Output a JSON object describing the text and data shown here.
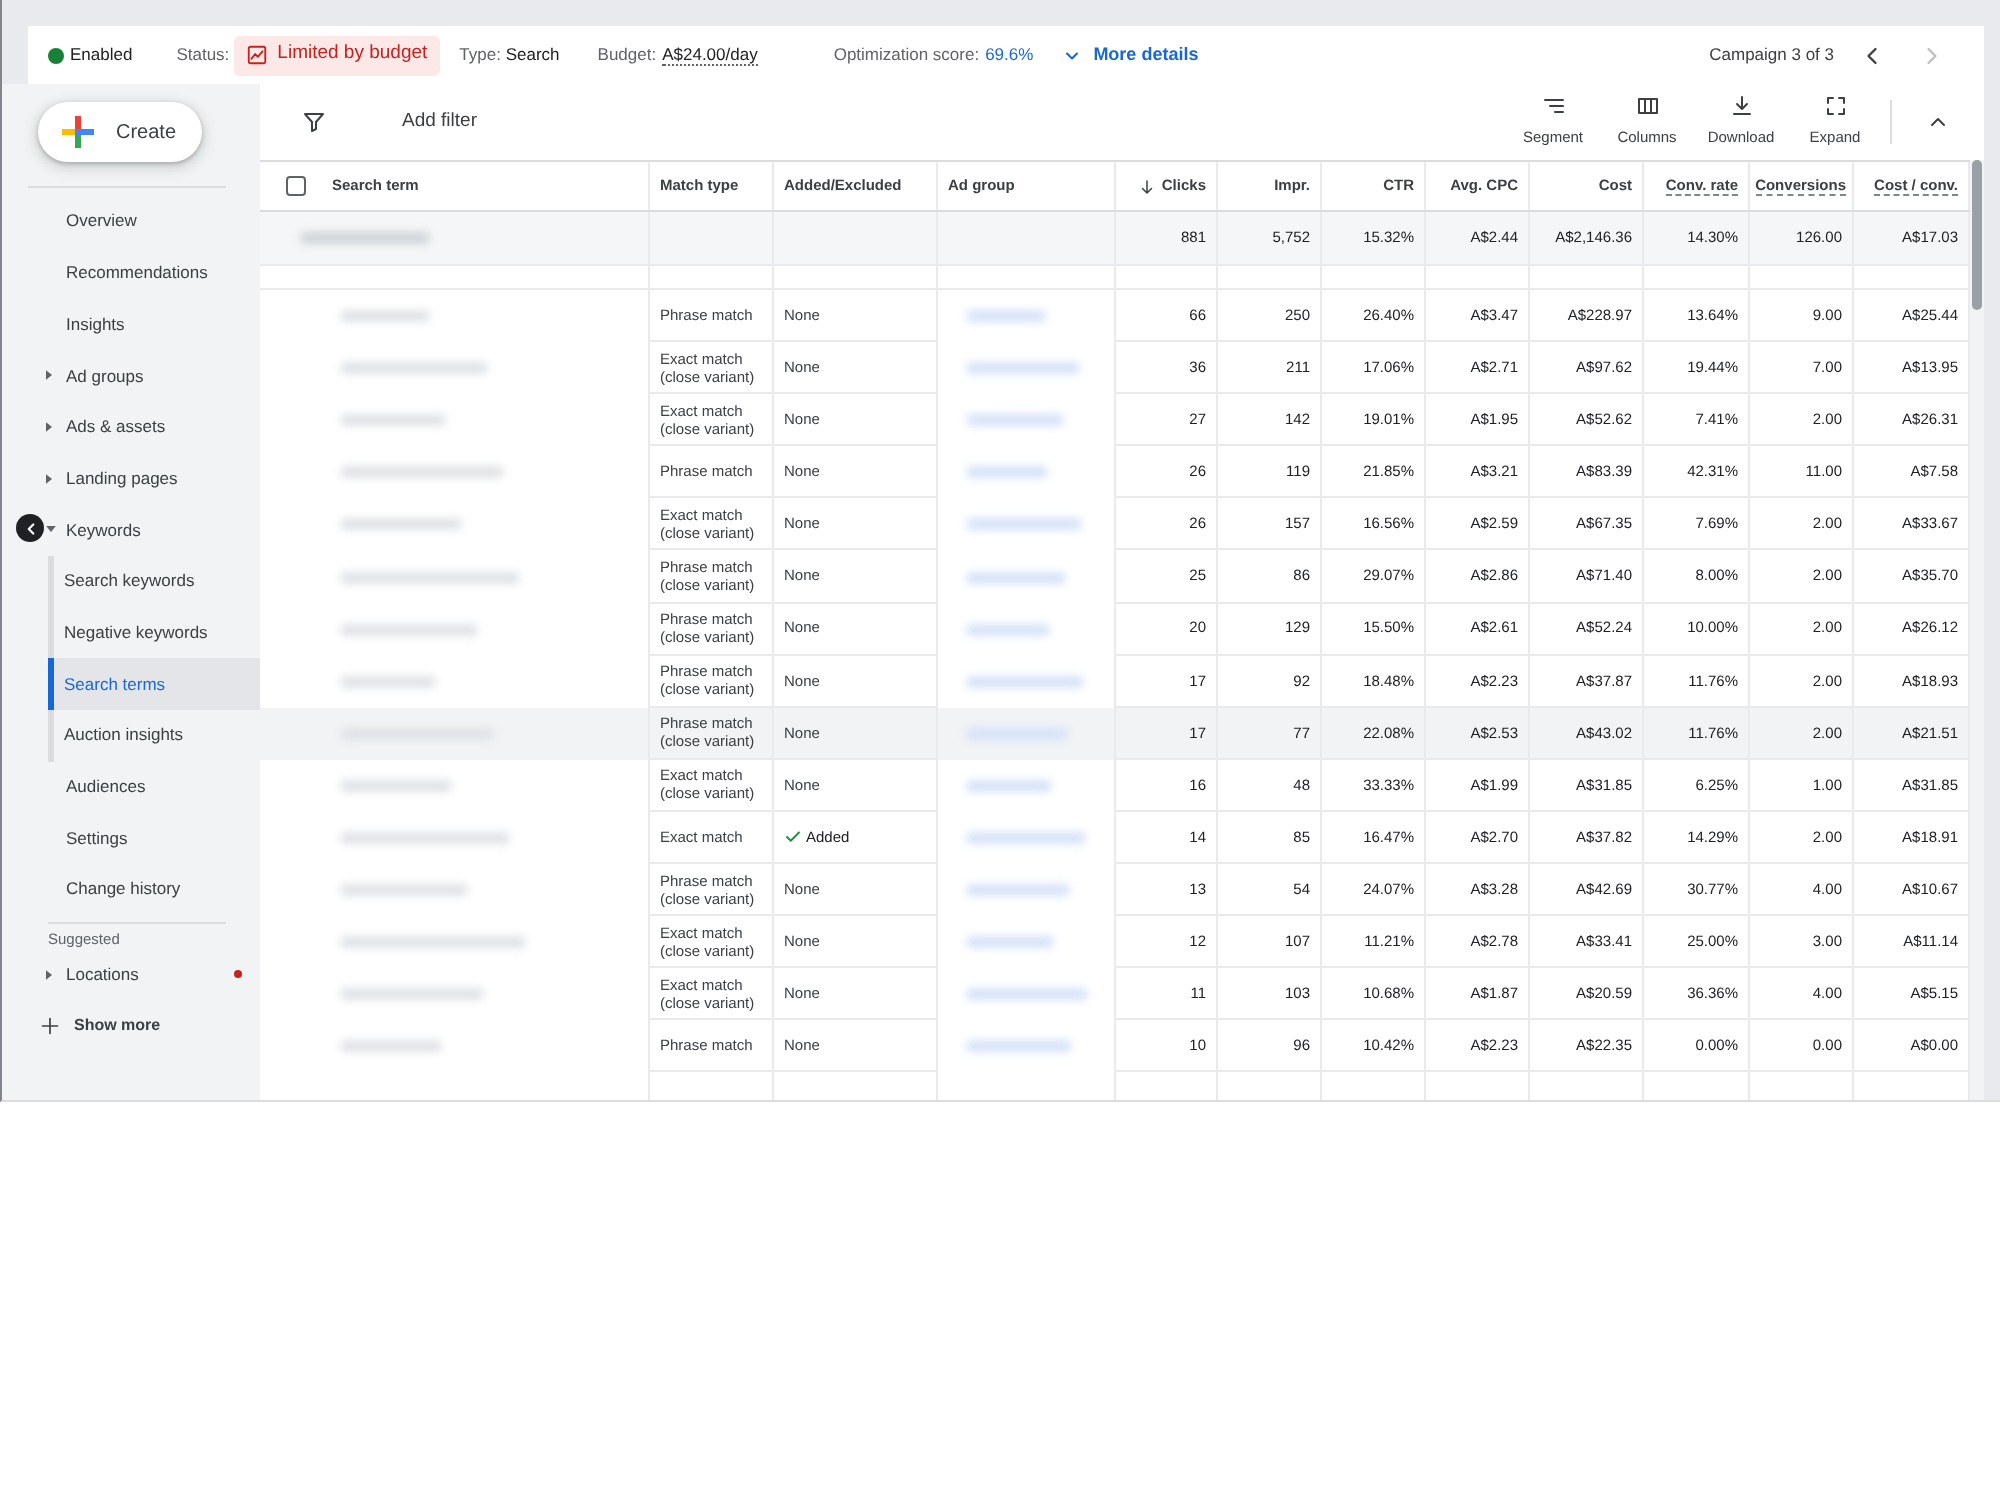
{
  "campaign_bar": {
    "status": {
      "label": "Enabled",
      "on": true
    },
    "status_field": {
      "label": "Status:",
      "badge": "Limited by budget"
    },
    "type": {
      "label": "Type:",
      "value": "Search"
    },
    "budget": {
      "label": "Budget:",
      "value": "A$24.00/day"
    },
    "optimization": {
      "label": "Optimization score:",
      "value": "69.6%"
    },
    "more_details": "More details",
    "pager": {
      "label": "Campaign 3 of 3",
      "previous_disabled": false,
      "next_disabled": true
    }
  },
  "sidebar": {
    "create_button": "Create",
    "items": [
      {
        "label": "Overview",
        "kind": "page",
        "selected": false
      },
      {
        "label": "Recommendations",
        "kind": "page",
        "selected": false
      },
      {
        "label": "Insights",
        "kind": "page",
        "selected": false
      },
      {
        "label": "Ad groups",
        "kind": "section",
        "expanded": false,
        "selected": false
      },
      {
        "label": "Ads & assets",
        "kind": "section",
        "expanded": false,
        "selected": false
      },
      {
        "label": "Landing pages",
        "kind": "section",
        "expanded": false,
        "selected": false
      },
      {
        "label": "Keywords",
        "kind": "section",
        "expanded": true,
        "selected": false,
        "children": [
          {
            "label": "Search keywords",
            "selected": false
          },
          {
            "label": "Negative keywords",
            "selected": false
          },
          {
            "label": "Search terms",
            "selected": true
          },
          {
            "label": "Auction insights",
            "selected": false
          }
        ]
      },
      {
        "label": "Audiences",
        "kind": "page",
        "selected": false
      },
      {
        "label": "Settings",
        "kind": "page",
        "selected": false
      },
      {
        "label": "Change history",
        "kind": "page",
        "selected": false
      }
    ],
    "suggested": {
      "title": "Suggested",
      "items": [
        {
          "label": "Locations",
          "kind": "section",
          "expanded": false,
          "selected": false,
          "alert": true
        }
      ]
    },
    "show_more": "Show more"
  },
  "toolbar": {
    "filter": "Add filter",
    "actions": [
      {
        "kind": "segment",
        "label": "Segment"
      },
      {
        "kind": "columns",
        "label": "Columns"
      },
      {
        "kind": "download",
        "label": "Download"
      },
      {
        "kind": "expand",
        "label": "Expand"
      }
    ]
  },
  "table": {
    "select_all_checked": false,
    "columns": [
      {
        "label": "Search term",
        "kind": "text",
        "sorted": false,
        "tooltip": false
      },
      {
        "label": "Match type",
        "kind": "text",
        "sorted": false,
        "tooltip": false
      },
      {
        "label": "Added/Excluded",
        "kind": "text",
        "sorted": false,
        "tooltip": false
      },
      {
        "label": "Ad group",
        "kind": "text",
        "sorted": false,
        "tooltip": false
      },
      {
        "label": "Clicks",
        "kind": "metric",
        "sorted": true,
        "tooltip": false
      },
      {
        "label": "Impr.",
        "kind": "metric",
        "sorted": false,
        "tooltip": false
      },
      {
        "label": "CTR",
        "kind": "metric",
        "sorted": false,
        "tooltip": false
      },
      {
        "label": "Avg. CPC",
        "kind": "metric",
        "sorted": false,
        "tooltip": false
      },
      {
        "label": "Cost",
        "kind": "metric",
        "sorted": false,
        "tooltip": false
      },
      {
        "label": "Conv. rate",
        "kind": "metric",
        "sorted": false,
        "tooltip": true
      },
      {
        "label": "Conversions",
        "kind": "metric",
        "sorted": false,
        "tooltip": true
      },
      {
        "label": "Cost / conv.",
        "kind": "metric",
        "sorted": false,
        "tooltip": true
      }
    ],
    "totals": [
      "881",
      "5,752",
      "15.32%",
      "A$2.44",
      "A$2,146.36",
      "14.30%",
      "126.00",
      "A$17.03"
    ],
    "rows": [
      {
        "match_type": "Phrase match",
        "added_excluded": "None",
        "added": false,
        "metrics": [
          "66",
          "250",
          "26.40%",
          "A$3.47",
          "A$228.97",
          "13.64%",
          "9.00",
          "A$25.44"
        ],
        "highlighted": false
      },
      {
        "match_type": "Exact match (close variant)",
        "added_excluded": "None",
        "added": false,
        "metrics": [
          "36",
          "211",
          "17.06%",
          "A$2.71",
          "A$97.62",
          "19.44%",
          "7.00",
          "A$13.95"
        ],
        "highlighted": false
      },
      {
        "match_type": "Exact match (close variant)",
        "added_excluded": "None",
        "added": false,
        "metrics": [
          "27",
          "142",
          "19.01%",
          "A$1.95",
          "A$52.62",
          "7.41%",
          "2.00",
          "A$26.31"
        ],
        "highlighted": false
      },
      {
        "match_type": "Phrase match",
        "added_excluded": "None",
        "added": false,
        "metrics": [
          "26",
          "119",
          "21.85%",
          "A$3.21",
          "A$83.39",
          "42.31%",
          "11.00",
          "A$7.58"
        ],
        "highlighted": false
      },
      {
        "match_type": "Exact match (close variant)",
        "added_excluded": "None",
        "added": false,
        "metrics": [
          "26",
          "157",
          "16.56%",
          "A$2.59",
          "A$67.35",
          "7.69%",
          "2.00",
          "A$33.67"
        ],
        "highlighted": false
      },
      {
        "match_type": "Phrase match (close variant)",
        "added_excluded": "None",
        "added": false,
        "metrics": [
          "25",
          "86",
          "29.07%",
          "A$2.86",
          "A$71.40",
          "8.00%",
          "2.00",
          "A$35.70"
        ],
        "highlighted": false
      },
      {
        "match_type": "Phrase match (close variant)",
        "added_excluded": "None",
        "added": false,
        "metrics": [
          "20",
          "129",
          "15.50%",
          "A$2.61",
          "A$52.24",
          "10.00%",
          "2.00",
          "A$26.12"
        ],
        "highlighted": false
      },
      {
        "match_type": "Phrase match (close variant)",
        "added_excluded": "None",
        "added": false,
        "metrics": [
          "17",
          "92",
          "18.48%",
          "A$2.23",
          "A$37.87",
          "11.76%",
          "2.00",
          "A$18.93"
        ],
        "highlighted": false
      },
      {
        "match_type": "Phrase match (close variant)",
        "added_excluded": "None",
        "added": false,
        "metrics": [
          "17",
          "77",
          "22.08%",
          "A$2.53",
          "A$43.02",
          "11.76%",
          "2.00",
          "A$21.51"
        ],
        "highlighted": true
      },
      {
        "match_type": "Exact match (close variant)",
        "added_excluded": "None",
        "added": false,
        "metrics": [
          "16",
          "48",
          "33.33%",
          "A$1.99",
          "A$31.85",
          "6.25%",
          "1.00",
          "A$31.85"
        ],
        "highlighted": false
      },
      {
        "match_type": "Exact match",
        "added_excluded": "Added",
        "added": true,
        "metrics": [
          "14",
          "85",
          "16.47%",
          "A$2.70",
          "A$37.82",
          "14.29%",
          "2.00",
          "A$18.91"
        ],
        "highlighted": false
      },
      {
        "match_type": "Phrase match (close variant)",
        "added_excluded": "None",
        "added": false,
        "metrics": [
          "13",
          "54",
          "24.07%",
          "A$3.28",
          "A$42.69",
          "30.77%",
          "4.00",
          "A$10.67"
        ],
        "highlighted": false
      },
      {
        "match_type": "Exact match (close variant)",
        "added_excluded": "None",
        "added": false,
        "metrics": [
          "12",
          "107",
          "11.21%",
          "A$2.78",
          "A$33.41",
          "25.00%",
          "3.00",
          "A$11.14"
        ],
        "highlighted": false
      },
      {
        "match_type": "Exact match (close variant)",
        "added_excluded": "None",
        "added": false,
        "metrics": [
          "11",
          "103",
          "10.68%",
          "A$1.87",
          "A$20.59",
          "36.36%",
          "4.00",
          "A$5.15"
        ],
        "highlighted": false
      },
      {
        "match_type": "Phrase match",
        "added_excluded": "None",
        "added": false,
        "metrics": [
          "10",
          "96",
          "10.42%",
          "A$2.23",
          "A$22.35",
          "0.00%",
          "0.00",
          "A$0.00"
        ],
        "highlighted": false
      }
    ]
  }
}
